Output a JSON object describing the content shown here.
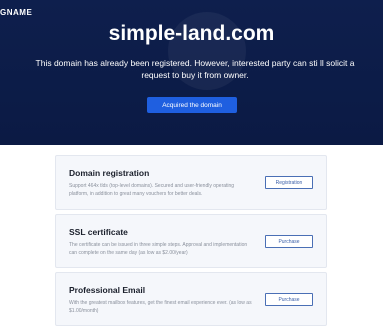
{
  "header": {
    "logo_text": "GNAME",
    "domain": "simple-land.com",
    "description": "This domain has already been registered. However, interested party can sti ll solicit a request to buy it from owner.",
    "acquire_label": "Acquired the domain"
  },
  "services": [
    {
      "title": "Domain registration",
      "description": "Support 464x tlds (top-level domains). Secured and user-friendly operating platform, in addition to great many vouchers for better deals.",
      "button": "Registration"
    },
    {
      "title": "SSL certificate",
      "description": "The certificate can be issued in three simple steps. Approval and implementation can complete on the same day (as low as $2.00/year)",
      "button": "Purchase"
    },
    {
      "title": "Professional Email",
      "description": "With the greatest mailbox features, get the finest email experience ever. (as low as $1.00/month)",
      "button": "Purchase"
    }
  ]
}
